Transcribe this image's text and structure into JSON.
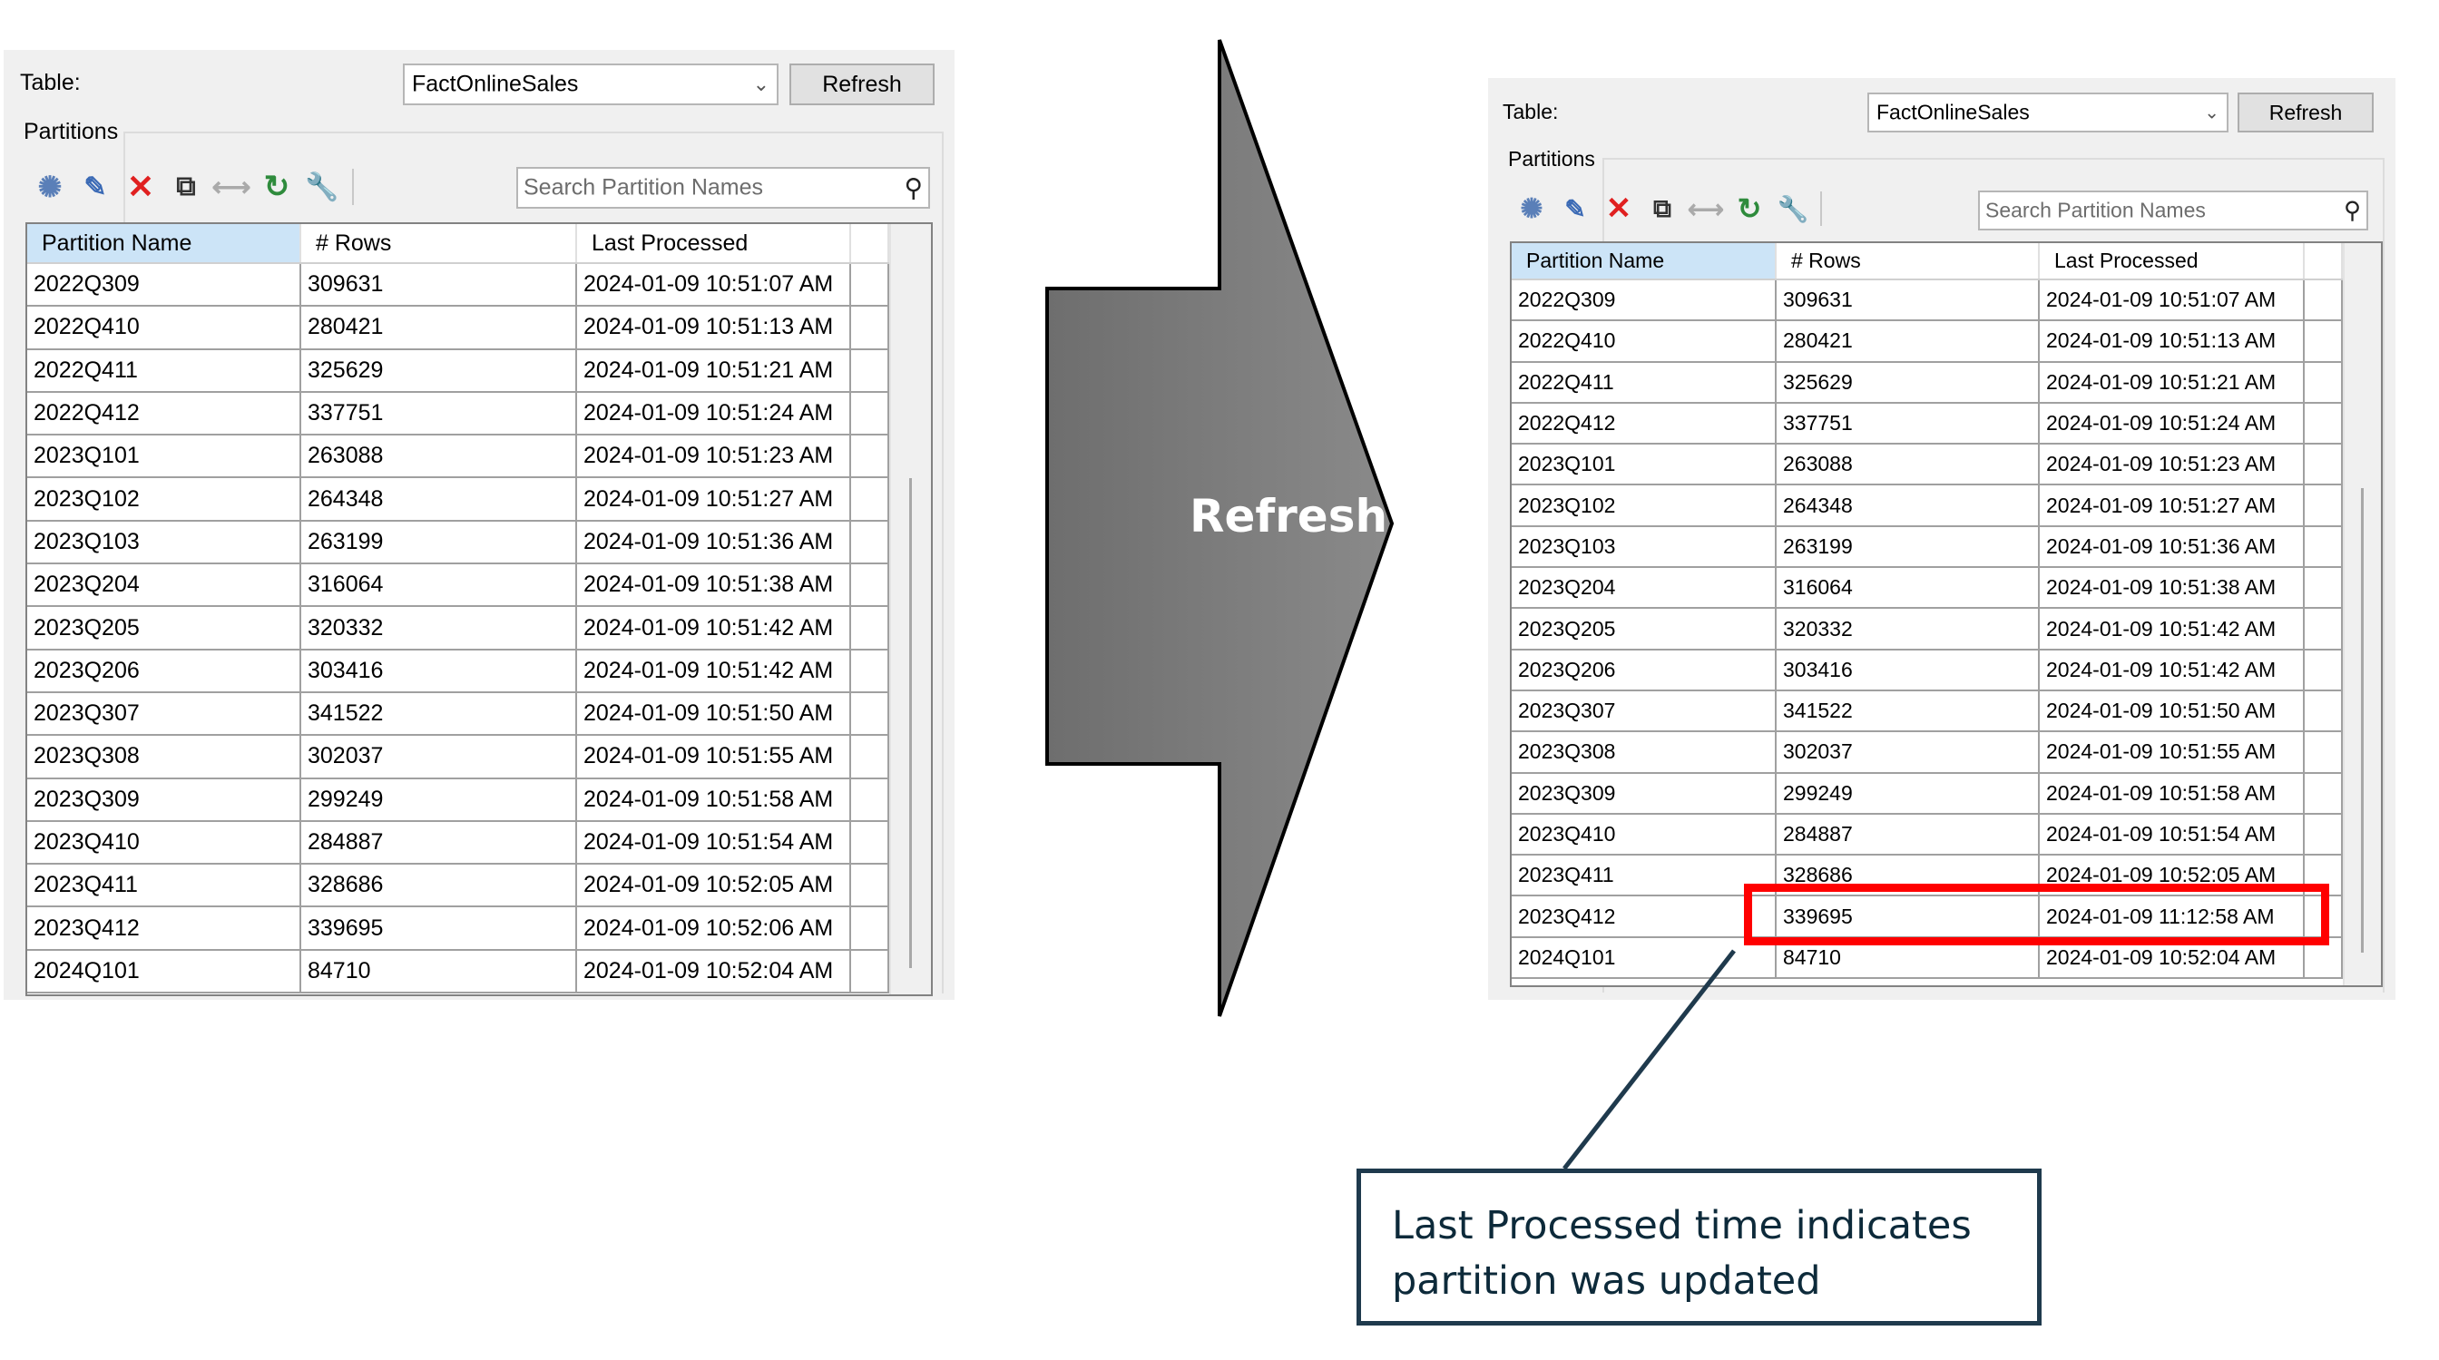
{
  "panel_before": {
    "table_label": "Table:",
    "table_value": "FactOnlineSales",
    "refresh_label": "Refresh",
    "partitions_label": "Partitions",
    "search_placeholder": "Search Partition Names",
    "columns": [
      "Partition Name",
      "# Rows",
      "Last Processed"
    ],
    "rows": [
      {
        "name": "2022Q309",
        "rows": "309631",
        "last": "2024-01-09 10:51:07 AM"
      },
      {
        "name": "2022Q410",
        "rows": "280421",
        "last": "2024-01-09 10:51:13 AM"
      },
      {
        "name": "2022Q411",
        "rows": "325629",
        "last": "2024-01-09 10:51:21 AM"
      },
      {
        "name": "2022Q412",
        "rows": "337751",
        "last": "2024-01-09 10:51:24 AM"
      },
      {
        "name": "2023Q101",
        "rows": "263088",
        "last": "2024-01-09 10:51:23 AM"
      },
      {
        "name": "2023Q102",
        "rows": "264348",
        "last": "2024-01-09 10:51:27 AM"
      },
      {
        "name": "2023Q103",
        "rows": "263199",
        "last": "2024-01-09 10:51:36 AM"
      },
      {
        "name": "2023Q204",
        "rows": "316064",
        "last": "2024-01-09 10:51:38 AM"
      },
      {
        "name": "2023Q205",
        "rows": "320332",
        "last": "2024-01-09 10:51:42 AM"
      },
      {
        "name": "2023Q206",
        "rows": "303416",
        "last": "2024-01-09 10:51:42 AM"
      },
      {
        "name": "2023Q307",
        "rows": "341522",
        "last": "2024-01-09 10:51:50 AM"
      },
      {
        "name": "2023Q308",
        "rows": "302037",
        "last": "2024-01-09 10:51:55 AM"
      },
      {
        "name": "2023Q309",
        "rows": "299249",
        "last": "2024-01-09 10:51:58 AM"
      },
      {
        "name": "2023Q410",
        "rows": "284887",
        "last": "2024-01-09 10:51:54 AM"
      },
      {
        "name": "2023Q411",
        "rows": "328686",
        "last": "2024-01-09 10:52:05 AM"
      },
      {
        "name": "2023Q412",
        "rows": "339695",
        "last": "2024-01-09 10:52:06 AM"
      },
      {
        "name": "2024Q101",
        "rows": "84710",
        "last": "2024-01-09 10:52:04 AM"
      }
    ]
  },
  "panel_after": {
    "table_label": "Table:",
    "table_value": "FactOnlineSales",
    "refresh_label": "Refresh",
    "partitions_label": "Partitions",
    "search_placeholder": "Search Partition Names",
    "columns": [
      "Partition Name",
      "# Rows",
      "Last Processed"
    ],
    "rows": [
      {
        "name": "2022Q309",
        "rows": "309631",
        "last": "2024-01-09 10:51:07 AM"
      },
      {
        "name": "2022Q410",
        "rows": "280421",
        "last": "2024-01-09 10:51:13 AM"
      },
      {
        "name": "2022Q411",
        "rows": "325629",
        "last": "2024-01-09 10:51:21 AM"
      },
      {
        "name": "2022Q412",
        "rows": "337751",
        "last": "2024-01-09 10:51:24 AM"
      },
      {
        "name": "2023Q101",
        "rows": "263088",
        "last": "2024-01-09 10:51:23 AM"
      },
      {
        "name": "2023Q102",
        "rows": "264348",
        "last": "2024-01-09 10:51:27 AM"
      },
      {
        "name": "2023Q103",
        "rows": "263199",
        "last": "2024-01-09 10:51:36 AM"
      },
      {
        "name": "2023Q204",
        "rows": "316064",
        "last": "2024-01-09 10:51:38 AM"
      },
      {
        "name": "2023Q205",
        "rows": "320332",
        "last": "2024-01-09 10:51:42 AM"
      },
      {
        "name": "2023Q206",
        "rows": "303416",
        "last": "2024-01-09 10:51:42 AM"
      },
      {
        "name": "2023Q307",
        "rows": "341522",
        "last": "2024-01-09 10:51:50 AM"
      },
      {
        "name": "2023Q308",
        "rows": "302037",
        "last": "2024-01-09 10:51:55 AM"
      },
      {
        "name": "2023Q309",
        "rows": "299249",
        "last": "2024-01-09 10:51:58 AM"
      },
      {
        "name": "2023Q410",
        "rows": "284887",
        "last": "2024-01-09 10:51:54 AM"
      },
      {
        "name": "2023Q411",
        "rows": "328686",
        "last": "2024-01-09 10:52:05 AM"
      },
      {
        "name": "2023Q412",
        "rows": "339695",
        "last": "2024-01-09 11:12:58 AM"
      },
      {
        "name": "2024Q101",
        "rows": "84710",
        "last": "2024-01-09 10:52:04 AM"
      }
    ]
  },
  "toolbar_icons": [
    "process-icon",
    "edit-icon",
    "delete-icon",
    "copy-icon",
    "merge-icon",
    "refresh-partition-icon",
    "settings-wrench-icon"
  ],
  "arrow": {
    "label": "Refresh",
    "fill": "#777777"
  },
  "highlight_color": "#ff0000",
  "callout": {
    "line1": "Last Processed time indicates",
    "line2": "partition was updated",
    "border_color": "#1f3a4d"
  }
}
